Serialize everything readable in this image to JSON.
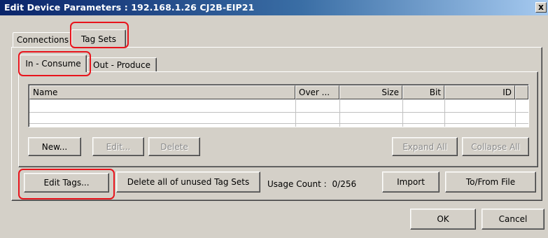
{
  "window": {
    "title": "Edit Device Parameters : 192.168.1.26 CJ2B-EIP21",
    "close_glyph": "x"
  },
  "tabs": {
    "connections": "Connections",
    "tag_sets": "Tag Sets"
  },
  "subtabs": {
    "in_consume": "In - Consume",
    "out_produce": "Out - Produce"
  },
  "table": {
    "columns": [
      "Name",
      "Over ...",
      "Size",
      "Bit",
      "ID"
    ]
  },
  "list_buttons": {
    "new": "New...",
    "edit": "Edit...",
    "delete": "Delete",
    "expand_all": "Expand All",
    "collapse_all": "Collapse All"
  },
  "bottom": {
    "edit_tags": "Edit Tags...",
    "delete_unused": "Delete all of unused Tag Sets",
    "usage_label": "Usage Count :",
    "usage_value": "0/256",
    "import": "Import",
    "to_from_file": "To/From File"
  },
  "dialog_buttons": {
    "ok": "OK",
    "cancel": "Cancel"
  },
  "colors": {
    "annotation": "#e8141c",
    "titlebar_start": "#0a246a",
    "face": "#d4d0c8"
  }
}
